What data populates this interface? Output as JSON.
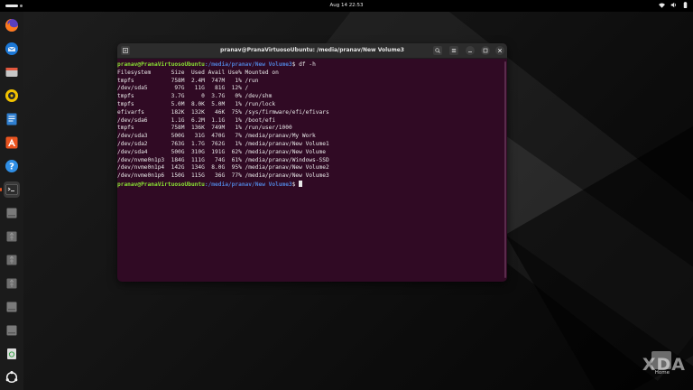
{
  "topbar": {
    "datetime": "Aug 14  22:53",
    "icons": [
      "wifi-icon",
      "volume-icon",
      "battery-icon"
    ]
  },
  "dock": {
    "items": [
      {
        "name": "firefox-icon"
      },
      {
        "name": "thunderbird-icon"
      },
      {
        "name": "files-icon"
      },
      {
        "name": "rhythmbox-icon"
      },
      {
        "name": "libreoffice-writer-icon"
      },
      {
        "name": "app-center-icon"
      },
      {
        "name": "help-icon"
      },
      {
        "name": "terminal-icon",
        "active": true
      },
      {
        "name": "drive-icon"
      },
      {
        "name": "usb-drive-icon"
      },
      {
        "name": "usb-drive-icon"
      },
      {
        "name": "usb-drive-icon"
      },
      {
        "name": "drive-icon"
      },
      {
        "name": "drive-icon"
      },
      {
        "name": "trash-icon"
      },
      {
        "name": "show-apps-icon"
      }
    ]
  },
  "terminal": {
    "title": "pranav@PranaVirtuosoUbuntu: /media/pranav/New Volume3",
    "prompt_user": "pranav@PranaVirtuosoUbuntu",
    "prompt_path": ":/media/pranav/New Volume3",
    "prompt_symbol": "$",
    "command": " df -h",
    "output": [
      "Filesystem      Size  Used Avail Use% Mounted on",
      "tmpfs           758M  2.4M  747M   1% /run",
      "/dev/sda5        97G   11G   81G  12% /",
      "tmpfs           3.7G     0  3.7G   0% /dev/shm",
      "tmpfs           5.0M  8.0K  5.0M   1% /run/lock",
      "efivarfs        182K  132K   46K  75% /sys/firmware/efi/efivars",
      "/dev/sda6       1.1G  6.2M  1.1G   1% /boot/efi",
      "tmpfs           758M  136K  749M   1% /run/user/1000",
      "/dev/sda3       500G   31G  470G   7% /media/pranav/My Work",
      "/dev/sda2       763G  1.7G  762G   1% /media/pranav/New Volume1",
      "/dev/sda4       500G  310G  191G  62% /media/pranav/New Volume",
      "/dev/nvme0n1p3  184G  111G   74G  61% /media/pranav/Windows-SSD",
      "/dev/nvme0n1p4  142G  134G  8.0G  95% /media/pranav/New Volume2",
      "/dev/nvme0n1p6  150G  115G   36G  77% /media/pranav/New Volume3"
    ]
  },
  "watermark": {
    "logo": "XDA",
    "home_label": "Home"
  },
  "colors": {
    "terminal_bg": "#300a24",
    "prompt_user": "#8ae234",
    "prompt_path": "#4f7fd6",
    "accent": "#e95420"
  }
}
